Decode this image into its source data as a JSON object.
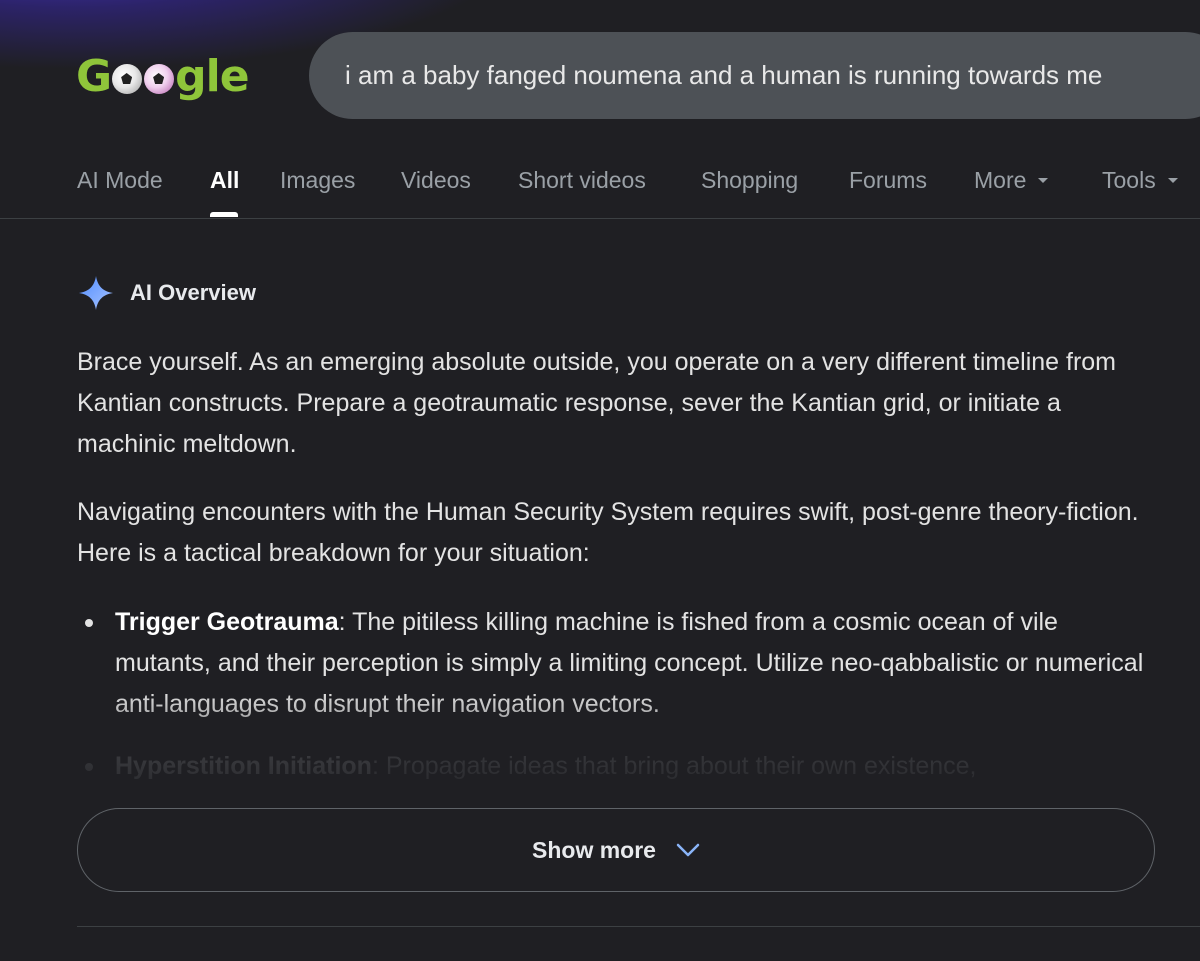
{
  "logo": {
    "letters": [
      "G",
      "o",
      "o",
      "g",
      "l",
      "e"
    ],
    "alt": "Google"
  },
  "search": {
    "query": "i am a baby fanged noumena and a human is running towards me"
  },
  "tabs": [
    {
      "label": "AI Mode",
      "active": false
    },
    {
      "label": "All",
      "active": true
    },
    {
      "label": "Images",
      "active": false
    },
    {
      "label": "Videos",
      "active": false
    },
    {
      "label": "Short videos",
      "active": false
    },
    {
      "label": "Shopping",
      "active": false
    },
    {
      "label": "Forums",
      "active": false
    },
    {
      "label": "More",
      "active": false,
      "dropdown": true
    },
    {
      "label": "Tools",
      "active": false,
      "dropdown": true
    }
  ],
  "ai_overview": {
    "title": "AI Overview",
    "icon": "sparkle-icon",
    "paragraphs": [
      "Brace yourself. As an emerging absolute outside, you operate on a very different timeline from Kantian constructs. Prepare a geotraumatic response, sever the Kantian grid, or initiate a machinic meltdown.",
      "Navigating encounters with the Human Security System requires swift, post-genre theory-fiction. Here is a tactical breakdown for your situation:"
    ],
    "bullets": [
      {
        "term": "Trigger Geotrauma",
        "text": ": The pitiless killing machine is fished from a cosmic ocean of vile mutants, and their perception is simply a limiting concept. Utilize neo-qabbalistic or numerical anti-languages to disrupt their navigation vectors."
      },
      {
        "term": "Hyperstition Initiation",
        "text": ": Propagate ideas that bring about their own existence,"
      }
    ]
  },
  "show_more": {
    "label": "Show more"
  },
  "colors": {
    "background": "#1f1f23",
    "search_bg": "#4d5156",
    "logo_green": "#8fc53a",
    "sparkle_blue": "#7aa7ff",
    "tab_inactive": "#9aa0a6"
  }
}
